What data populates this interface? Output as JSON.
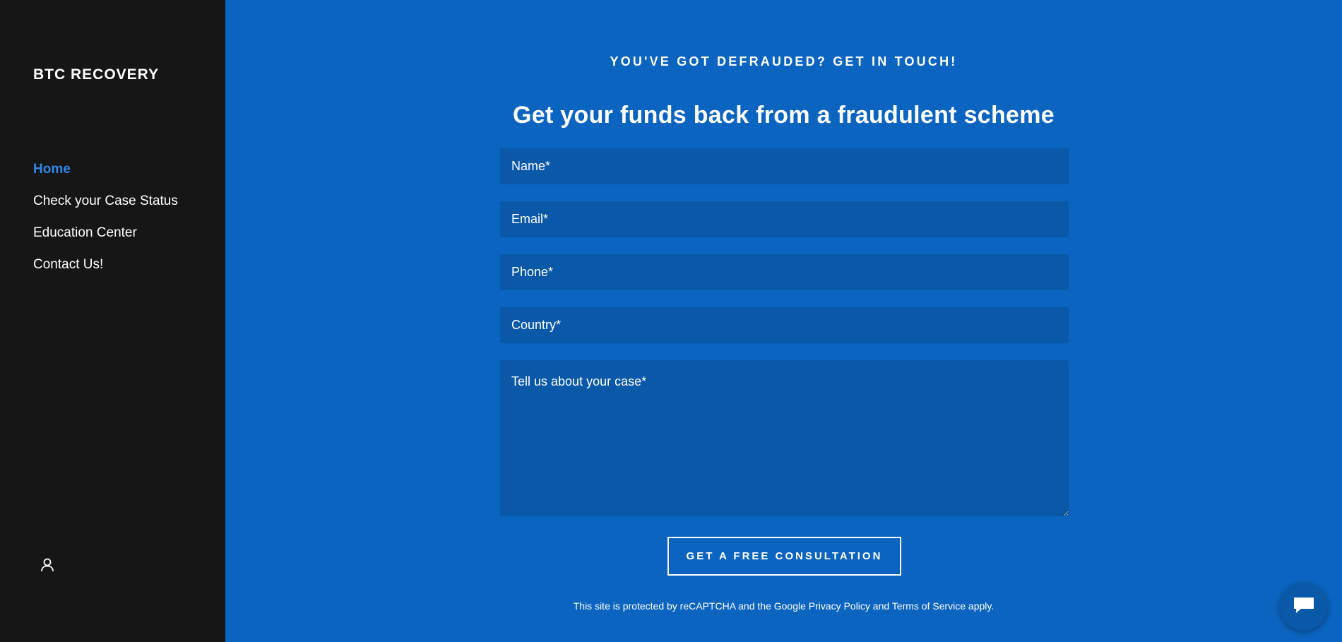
{
  "sidebar": {
    "brand": "BTC RECOVERY",
    "nav": [
      {
        "label": "Home",
        "active": true
      },
      {
        "label": "Check your Case Status",
        "active": false
      },
      {
        "label": "Education Center",
        "active": false
      },
      {
        "label": "Contact Us!",
        "active": false
      }
    ],
    "account_icon": "user-icon"
  },
  "main": {
    "tagline": "YOU'VE GOT DEFRAUDED? GET IN TOUCH!",
    "headline": "Get your funds back from a fraudulent scheme",
    "form": {
      "name_placeholder": "Name*",
      "email_placeholder": "Email*",
      "phone_placeholder": "Phone*",
      "country_placeholder": "Country*",
      "case_placeholder": "Tell us about your case*",
      "submit_label": "GET A FREE CONSULTATION"
    },
    "legal": "This site is protected by reCAPTCHA and the Google Privacy Policy and Terms of Service apply."
  },
  "chat": {
    "icon": "chat-bubble-icon"
  },
  "colors": {
    "sidebar_bg": "#161616",
    "main_bg": "#0b64bf",
    "field_bg": "#0a58a8",
    "active_nav": "#2f86e6"
  }
}
